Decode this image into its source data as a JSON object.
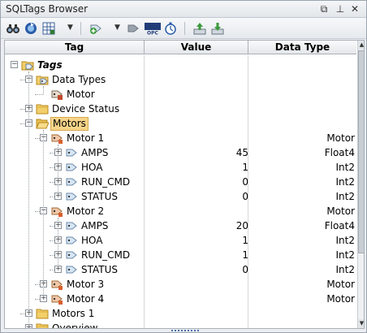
{
  "window": {
    "title": "SQLTags Browser",
    "controls": [
      "restore-icon",
      "pin-icon",
      "close-icon"
    ]
  },
  "toolbar": {
    "icons": [
      "binoculars-icon",
      "refresh-icon",
      "grid-icon",
      "add-tag-icon",
      "folder-tag-icon",
      "opc-icon",
      "clock-icon",
      "export-icon",
      "import-icon"
    ]
  },
  "columns": {
    "tag": "Tag",
    "value": "Value",
    "type": "Data Type"
  },
  "accent": "#f5d48a",
  "rows": [
    {
      "label": "Tags",
      "value": "",
      "type": "",
      "icon": "tags-folder-icon",
      "expanded": true
    },
    {
      "label": "Data Types",
      "value": "",
      "type": "",
      "icon": "datatypes-folder-icon",
      "expanded": true
    },
    {
      "label": "Motor",
      "value": "",
      "type": "",
      "icon": "udt-icon"
    },
    {
      "label": "Device Status",
      "value": "",
      "type": "",
      "icon": "folder-icon",
      "expanded": false
    },
    {
      "label": "Motors",
      "value": "",
      "type": "",
      "icon": "folder-open-icon",
      "expanded": true,
      "selected": true
    },
    {
      "label": "Motor 1",
      "value": "",
      "type": "Motor",
      "icon": "udt-instance-icon",
      "expanded": true
    },
    {
      "label": "AMPS",
      "value": "45",
      "type": "Float4",
      "icon": "tag-icon",
      "expanded": false
    },
    {
      "label": "HOA",
      "value": "1",
      "type": "Int2",
      "icon": "tag-icon",
      "expanded": false
    },
    {
      "label": "RUN_CMD",
      "value": "0",
      "type": "Int2",
      "icon": "tag-icon",
      "expanded": false
    },
    {
      "label": "STATUS",
      "value": "0",
      "type": "Int2",
      "icon": "tag-icon",
      "expanded": false
    },
    {
      "label": "Motor 2",
      "value": "",
      "type": "Motor",
      "icon": "udt-instance-icon",
      "expanded": true
    },
    {
      "label": "AMPS",
      "value": "20",
      "type": "Float4",
      "icon": "tag-icon",
      "expanded": false
    },
    {
      "label": "HOA",
      "value": "1",
      "type": "Int2",
      "icon": "tag-icon",
      "expanded": false
    },
    {
      "label": "RUN_CMD",
      "value": "1",
      "type": "Int2",
      "icon": "tag-icon",
      "expanded": false
    },
    {
      "label": "STATUS",
      "value": "0",
      "type": "Int2",
      "icon": "tag-icon",
      "expanded": false
    },
    {
      "label": "Motor 3",
      "value": "",
      "type": "Motor",
      "icon": "udt-instance-icon",
      "expanded": false
    },
    {
      "label": "Motor 4",
      "value": "",
      "type": "Motor",
      "icon": "udt-instance-icon",
      "expanded": false
    },
    {
      "label": "Motors 1",
      "value": "",
      "type": "",
      "icon": "folder-icon",
      "expanded": false
    },
    {
      "label": "Overview",
      "value": "",
      "type": "",
      "icon": "folder-icon",
      "expanded": false
    }
  ]
}
